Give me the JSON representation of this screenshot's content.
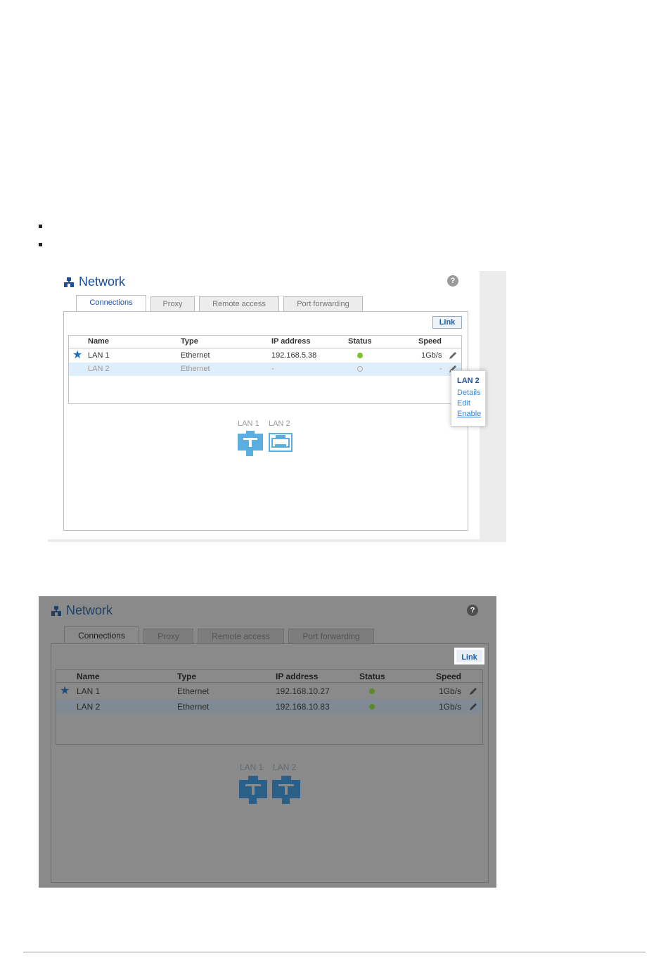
{
  "bullets": 2,
  "panel1": {
    "title": "Network",
    "help": "?",
    "tabs": [
      "Connections",
      "Proxy",
      "Remote access",
      "Port forwarding"
    ],
    "link_label": "Link",
    "columns": [
      "Name",
      "Type",
      "IP address",
      "Status",
      "Speed"
    ],
    "rows": [
      {
        "name": "LAN 1",
        "type": "Ethernet",
        "ip": "192.168.5.38",
        "status": "connected",
        "speed": "1Gb/s",
        "primary": true
      },
      {
        "name": "LAN 2",
        "type": "Ethernet",
        "ip": "-",
        "status": "disabled",
        "speed": "-",
        "primary": false
      }
    ],
    "popup": {
      "title": "LAN 2",
      "items": [
        "Details",
        "Edit",
        "Enable"
      ]
    },
    "ports": [
      "LAN 1",
      "LAN 2"
    ],
    "colors": {
      "accent": "#1d4e9c",
      "status_on": "#7cc02c",
      "port": "#5aaee0"
    }
  },
  "panel2": {
    "title": "Network",
    "help": "?",
    "tabs": [
      "Connections",
      "Proxy",
      "Remote access",
      "Port forwarding"
    ],
    "link_label": "Link",
    "columns": [
      "Name",
      "Type",
      "IP address",
      "Status",
      "Speed"
    ],
    "rows": [
      {
        "name": "LAN 1",
        "type": "Ethernet",
        "ip": "192.168.10.27",
        "status": "connected",
        "speed": "1Gb/s",
        "primary": true
      },
      {
        "name": "LAN 2",
        "type": "Ethernet",
        "ip": "192.168.10.83",
        "status": "connected",
        "speed": "1Gb/s",
        "primary": false
      }
    ],
    "ports": [
      "LAN 1",
      "LAN 2"
    ]
  }
}
